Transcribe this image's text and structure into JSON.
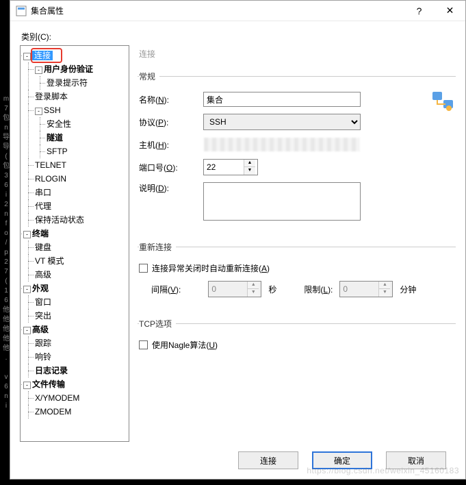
{
  "titlebar": {
    "title": "集合属性"
  },
  "category_label": "类别(C):",
  "tree": {
    "n_connect": "连接",
    "n_auth": "用户身份验证",
    "n_loginprompt": "登录提示符",
    "n_loginscript": "登录脚本",
    "n_ssh": "SSH",
    "n_security": "安全性",
    "n_tunnel": "隧道",
    "n_sftp": "SFTP",
    "n_telnet": "TELNET",
    "n_rlogin": "RLOGIN",
    "n_serial": "串口",
    "n_proxy": "代理",
    "n_keepalive": "保持活动状态",
    "n_terminal": "终端",
    "n_keyboard": "键盘",
    "n_vtmode": "VT 模式",
    "n_adv1": "高级",
    "n_appearance": "外观",
    "n_window": "窗口",
    "n_highlight": "突出",
    "n_advanced": "高级",
    "n_trace": "跟踪",
    "n_bell": "响铃",
    "n_logging": "日志记录",
    "n_filetrans": "文件传输",
    "n_xymodem": "X/YMODEM",
    "n_zmodem": "ZMODEM"
  },
  "right": {
    "header": "连接",
    "group_general": "常规",
    "name_label": "名称(N):",
    "name_value": "集合",
    "proto_label": "协议(P):",
    "proto_value": "SSH",
    "host_label": "主机(H):",
    "port_label": "端口号(O):",
    "port_value": "22",
    "desc_label": "说明(D):",
    "group_reconnect": "重新连接",
    "reconnect_chk": "连接异常关闭时自动重新连接(A)",
    "interval_label": "间隔(V):",
    "interval_value": "0",
    "interval_unit": "秒",
    "limit_label": "限制(L):",
    "limit_value": "0",
    "limit_unit": "分钟",
    "group_tcp": "TCP选项",
    "nagle_chk": "使用Nagle算法(U)"
  },
  "buttons": {
    "connect": "连接",
    "ok": "确定",
    "cancel": "取消"
  }
}
